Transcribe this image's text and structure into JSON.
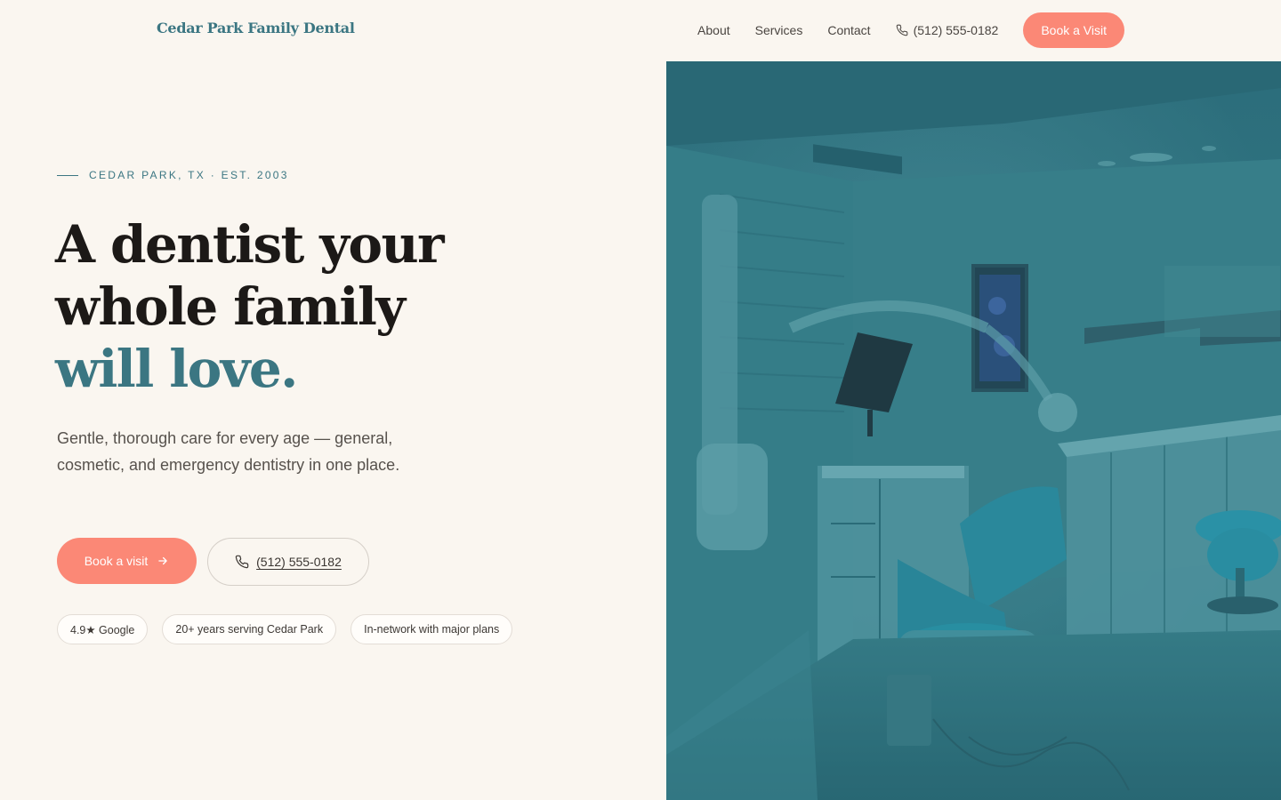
{
  "header": {
    "logo": "Cedar Park Family Dental",
    "nav": [
      {
        "label": "About"
      },
      {
        "label": "Services"
      },
      {
        "label": "Contact"
      }
    ],
    "phone": "(512) 555-0182",
    "cta": "Book a Visit"
  },
  "hero": {
    "eyebrow": "CEDAR PARK, TX · EST. 2003",
    "headline_lines": [
      "A dentist your",
      "whole family"
    ],
    "headline_accent": "will love.",
    "lede": "Gentle, thorough care for every age — general, cosmetic, and emergency dentistry in one place.",
    "primary_cta": "Book a visit",
    "phone_cta": "(512) 555-0182",
    "chips": [
      "4.9★ Google",
      "20+ years serving Cedar Park",
      "In-network with major plans"
    ]
  },
  "colors": {
    "accent": "#3b7682",
    "coral": "#fb8876",
    "background": "#faf6f0"
  },
  "icons": {
    "phone": "phone-icon",
    "arrow": "arrow-right-icon"
  }
}
